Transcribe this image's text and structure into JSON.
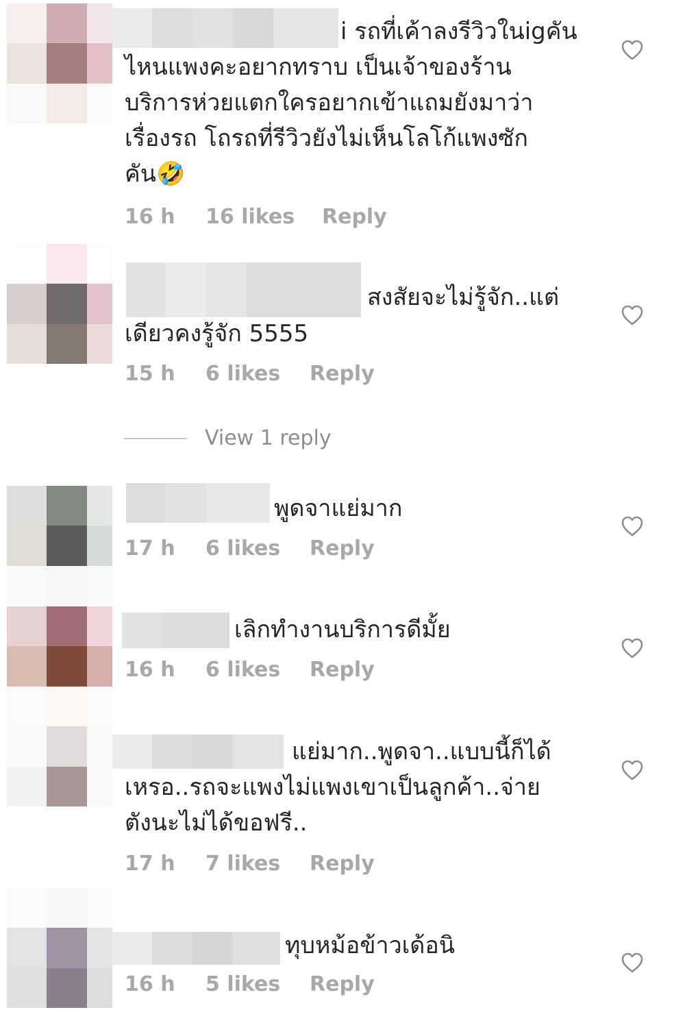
{
  "comments": [
    {
      "text_lines": [
        "i รถที่เค้าลงรีวิวในigคัน",
        "ไหนแพงคะอยากทราบ เป็นเจ้าของร้าน",
        "บริการห่วยแตกใครอยากเข้าแถมยังมาว่า",
        "เรื่องรถ โถรถที่รีวิวยังไม่เห็นโลโก้แพงซัก",
        "คัน🤣"
      ],
      "time": "16 h",
      "likes": "16 likes",
      "reply": "Reply",
      "avatar_colors": [
        "#f7eeee",
        "#cfadb4",
        "#f3e6ea",
        "#ede2dc",
        "#a47e7c",
        "#e2c2c4",
        "#fbf9f8",
        "#f5ebe6",
        "#fdfbfa"
      ]
    },
    {
      "text_lines": [
        "สงสัยจะไม่รู้จัก..แต่",
        "เดียวคงรู้จัก 5555"
      ],
      "time": "15 h",
      "likes": "6 likes",
      "reply": "Reply",
      "avatar_colors": [
        "#fdfdfd",
        "#f9e8ee",
        "#fdfdfd",
        "#dbcdcd",
        "#6f6a6b",
        "#e2c3cd",
        "#e7deda",
        "#857a72",
        "#ecdbdc"
      ]
    },
    {
      "text_lines": [
        "พูดจาแย่มาก"
      ],
      "time": "17 h",
      "likes": "6 likes",
      "reply": "Reply",
      "avatar_colors": [
        "#dcdfdc",
        "#828a82",
        "#e3e6e2",
        "#e0ded5",
        "#5a5c59",
        "#d6dad8",
        "#fafaf9",
        "#f7f7f6",
        "#fafafa"
      ]
    },
    {
      "text_lines": [
        "เลิกทำงานบริการดีมั้ย"
      ],
      "time": "16 h",
      "likes": "6 likes",
      "reply": "Reply",
      "avatar_colors": [
        "#e4d2d2",
        "#a06e74",
        "#f0d5da",
        "#d8bdb3",
        "#7f4b3b",
        "#d5aeaa",
        "#fbfafa",
        "#fcf5f0",
        "#fbfbfb"
      ]
    },
    {
      "text_lines": [
        "แย่มาก..พูดจา..แบบนี้ก็ได้",
        "เหรอ..รถจะแพงไม่แพงเขาเป็นลูกค้า..จ่าย",
        "ตังนะไม่ได้ขอฟรี.."
      ],
      "time": "17 h",
      "likes": "7 likes",
      "reply": "Reply",
      "avatar_colors": [
        "#fbfbfb",
        "#e0dcdb",
        "#fbfbfb",
        "#f3f2f2",
        "#a99797",
        "#fafafa",
        "#fafafa",
        "#fafafa",
        "#fafafa"
      ]
    },
    {
      "text_lines": [
        "ทุบหม้อข้าวเด้อนิ"
      ],
      "time": "16 h",
      "likes": "5 likes",
      "reply": "Reply",
      "avatar_colors": [
        "#e3e3e5",
        "#a193a6",
        "#e5e3e6",
        "#e0dee1",
        "#8c7f8d",
        "#e0dde1",
        "#fbfbfb",
        "#fbfbfb",
        "#fbfbfb"
      ]
    }
  ],
  "view_replies_label": "View 1 reply",
  "heart_icon": "heart-outline-icon",
  "muted_color": "#a8a8a8"
}
